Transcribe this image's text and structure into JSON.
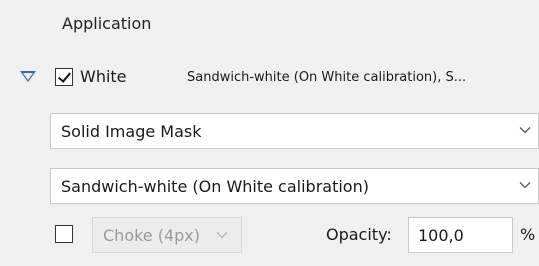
{
  "section": {
    "title": "Application"
  },
  "white_layer": {
    "checked": true,
    "label": "White",
    "summary": "Sandwich-white (On White calibration), S..."
  },
  "mask_select": {
    "value": "Solid Image Mask"
  },
  "calibration_select": {
    "value": "Sandwich-white (On White calibration)"
  },
  "choke": {
    "checked": false,
    "value": "Choke (4px)",
    "enabled": false
  },
  "opacity": {
    "label": "Opacity:",
    "value": "100,0",
    "unit": "%"
  },
  "colors": {
    "panel_bg": "#f0f0f0",
    "expand_arrow": "#3b66b3",
    "field_bg": "#ffffff",
    "disabled_text": "#9a9a9a"
  }
}
